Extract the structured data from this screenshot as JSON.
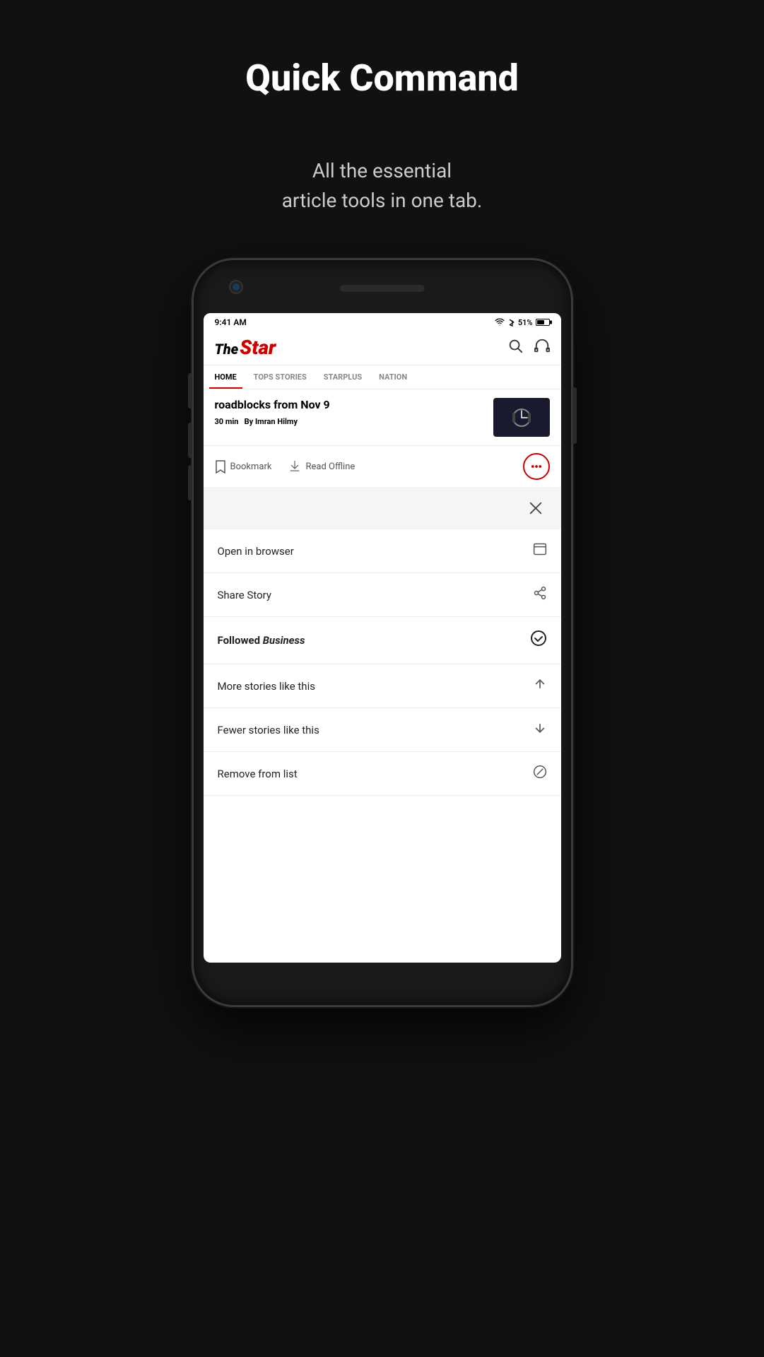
{
  "page": {
    "title": "Quick Command",
    "subtitle": "All the essential\narticle tools in one tab."
  },
  "status_bar": {
    "time": "9:41 AM",
    "battery_percent": "51%",
    "wifi": "WiFi",
    "bluetooth": "BT"
  },
  "app": {
    "logo_the": "The",
    "logo_star": "Star",
    "nav_tabs": [
      {
        "label": "HOME",
        "active": true
      },
      {
        "label": "TOPS STORIES",
        "active": false
      },
      {
        "label": "STARPLUS",
        "active": false
      },
      {
        "label": "NATION",
        "active": false
      }
    ]
  },
  "article": {
    "title": "roadblocks from Nov 9",
    "read_time": "30 min",
    "author_prefix": "By",
    "author": "Imran Hilmy"
  },
  "toolbar": {
    "bookmark_label": "Bookmark",
    "read_offline_label": "Read Offline"
  },
  "quick_command": {
    "close_icon": "×",
    "items": [
      {
        "label": "Open in browser",
        "icon_type": "browser"
      },
      {
        "label": "Share Story",
        "icon_type": "share"
      },
      {
        "label_prefix": "Followed ",
        "label_em": "Business",
        "bold": true,
        "icon_type": "checked"
      },
      {
        "label": "More stories like this",
        "icon_type": "arrow-up"
      },
      {
        "label": "Fewer stories like this",
        "icon_type": "arrow-down"
      },
      {
        "label": "Remove from list",
        "icon_type": "cancel"
      }
    ]
  }
}
